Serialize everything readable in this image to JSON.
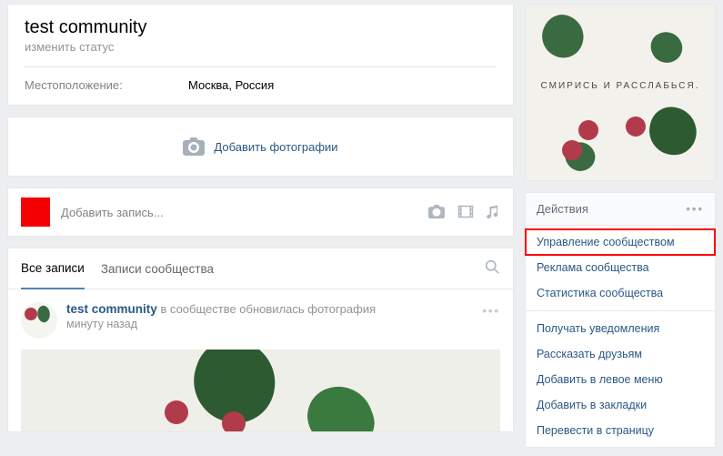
{
  "header": {
    "title": "test community",
    "status": "изменить статус",
    "location_label": "Местоположение:",
    "location_value": "Москва, Россия"
  },
  "add_photos": {
    "label": "Добавить фотографии"
  },
  "composer": {
    "placeholder": "Добавить запись..."
  },
  "wall": {
    "tab_all": "Все записи",
    "tab_community": "Записи сообщества"
  },
  "post": {
    "author": "test community",
    "action_text": "в сообществе обновилась фотография",
    "time": "минуту назад"
  },
  "side_avatar": {
    "caption": "СМИРИСЬ И РАССЛАБЬСЯ."
  },
  "actions": {
    "heading": "Действия",
    "items": [
      "Управление сообществом",
      "Реклама сообщества",
      "Статистика сообщества",
      "Получать уведомления",
      "Рассказать друзьям",
      "Добавить в левое меню",
      "Добавить в закладки",
      "Перевести в страницу"
    ]
  }
}
